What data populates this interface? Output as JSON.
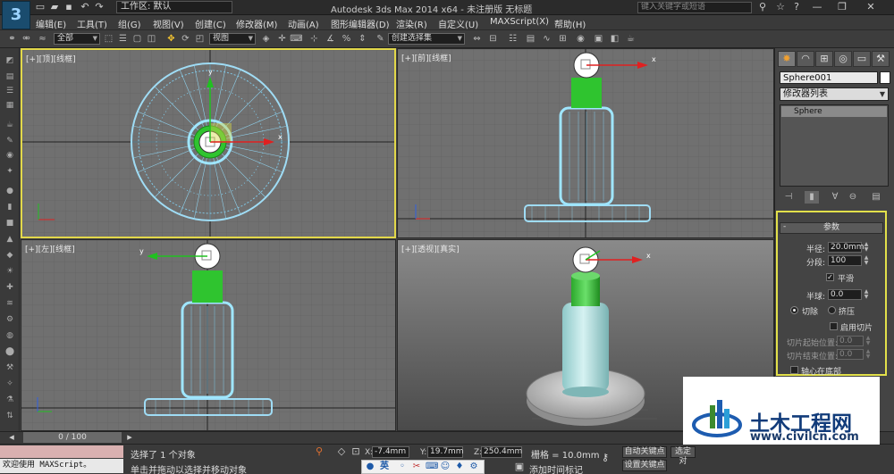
{
  "app": {
    "logo": "3",
    "workspace_label": "工作区: 默认",
    "title": "Autodesk 3ds Max  2014 x64   - 未注册版   无标题",
    "search_placeholder": "键入关键字或短语"
  },
  "menu": [
    "编辑(E)",
    "工具(T)",
    "组(G)",
    "视图(V)",
    "创建(C)",
    "修改器(M)",
    "动画(A)",
    "图形编辑器(D)",
    "渲染(R)",
    "自定义(U)",
    "MAXScript(X)",
    "帮助(H)"
  ],
  "toolbar": {
    "filter_select": "全部",
    "coord_select": "视图",
    "selection_set": "创建选择集"
  },
  "viewports": {
    "top": "[+][顶][线框]",
    "front": "[+][前][线框]",
    "left": "[+][左][线框]",
    "persp": "[+][透视][真实]"
  },
  "command_panel": {
    "object_name": "Sphere001",
    "modifier_list": "修改器列表",
    "stack_item": "Sphere",
    "rollout_title": "参数",
    "radius_label": "半径:",
    "radius_value": "20.0mm",
    "segments_label": "分段:",
    "segments_value": "100",
    "smooth_label": "平滑",
    "hemisphere_label": "半球:",
    "hemisphere_value": "0.0",
    "chop_label": "切除",
    "squash_label": "挤压",
    "slice_on_label": "启用切片",
    "slice_from_label": "切片起始位置:",
    "slice_from_value": "0.0",
    "slice_to_label": "切片结束位置:",
    "slice_to_value": "0.0",
    "base_pivot_label": "轴心在底部"
  },
  "timeline": {
    "slider_label": "0 / 100"
  },
  "status": {
    "listener_text": "欢迎使用 MAXScript。",
    "selected_text": "选择了 1 个对象",
    "prompt_text": "单击并拖动以选择并移动对象",
    "x_label": "X:",
    "x_value": "-7.4mm",
    "y_label": "Y:",
    "y_value": "19.7mm",
    "z_label": "Z:",
    "z_value": "250.4mm",
    "grid_text": "栅格 = 10.0mm",
    "autokey": "自动关键点",
    "setkey": "设置关键点",
    "add_time_tag": "添加时间标记",
    "selected_obj": "选定对"
  },
  "watermark": {
    "name": "土木工程网",
    "url": "www.civilcn.com"
  },
  "tray": {
    "ime": "英"
  },
  "colors": {
    "active_viewport": "#e2d84a",
    "wire_blue": "#7fd4f0",
    "bottle_green": "#2fc42f",
    "x_axis": "#e02020",
    "y_axis": "#20c020"
  }
}
